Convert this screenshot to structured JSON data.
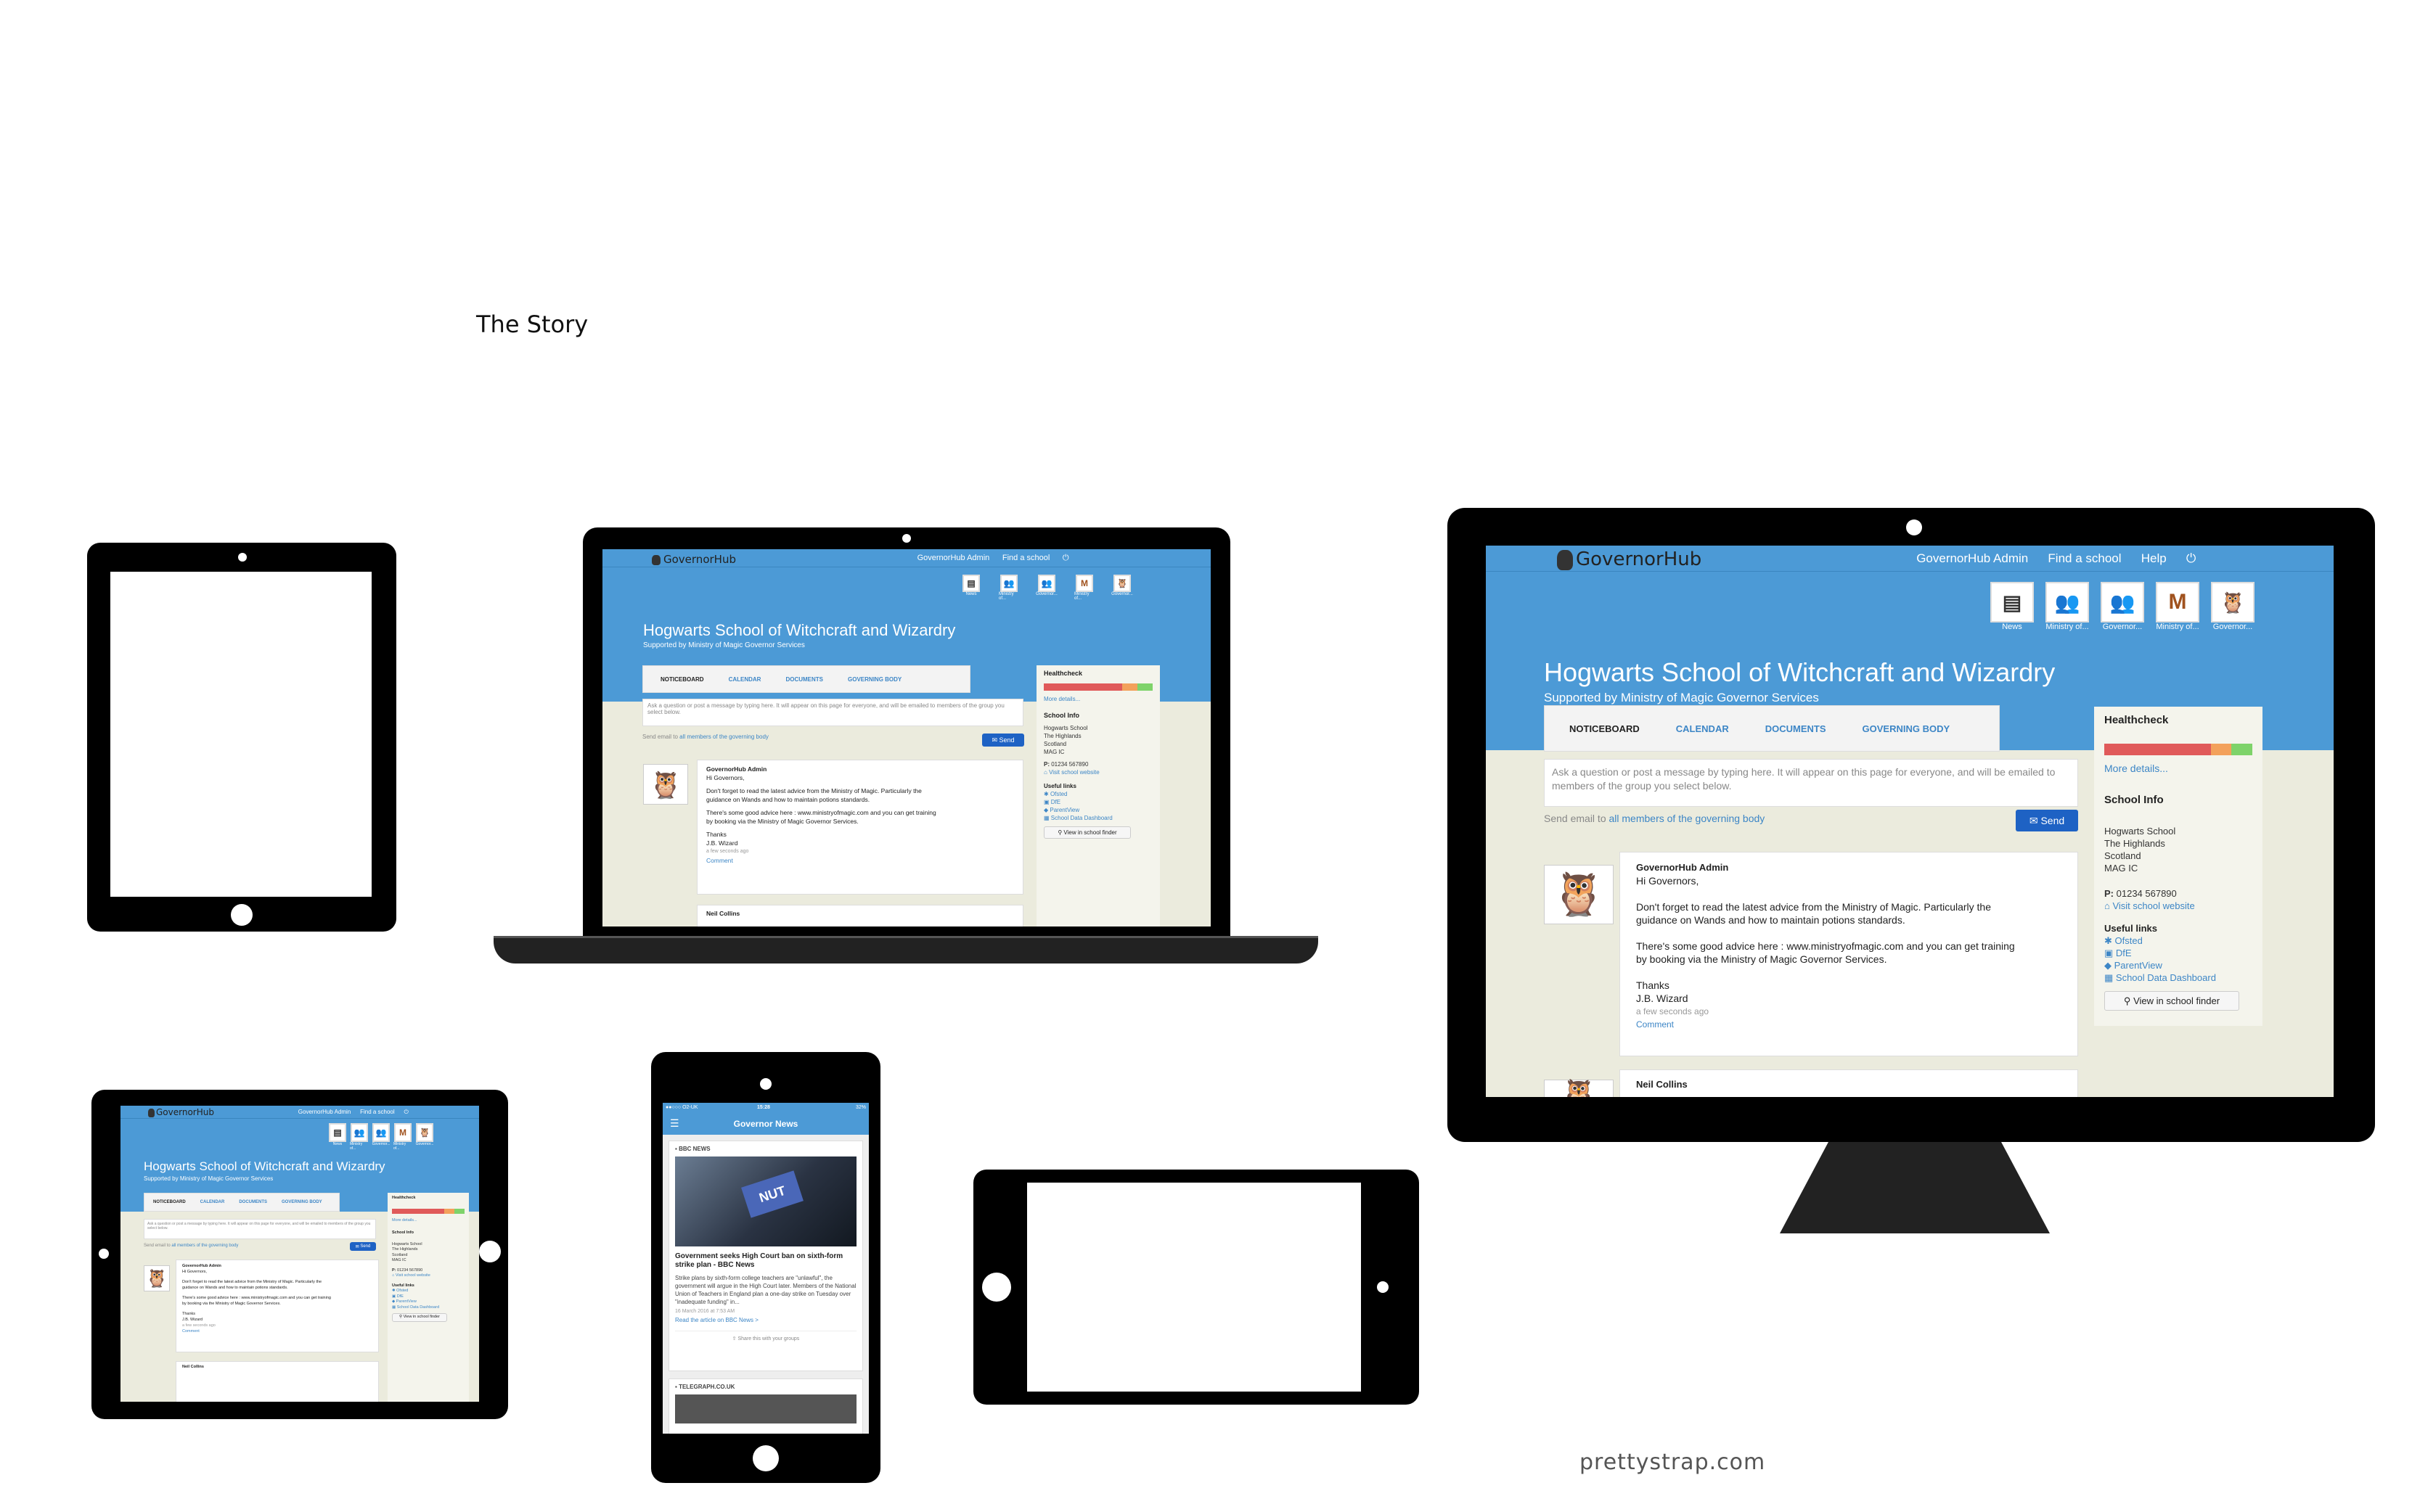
{
  "page_title": "The Story",
  "footer_brand": "prettystrap.com",
  "site": {
    "logo": "GovernorHub",
    "nav": {
      "admin": "GovernorHub Admin",
      "find": "Find a school",
      "help": "Help"
    },
    "groups": [
      "News",
      "Ministry of...",
      "Governor...",
      "Ministry of...",
      "Governor..."
    ],
    "school_name": "Hogwarts School of Witchcraft and Wizardry",
    "school_sub": "Supported by Ministry of Magic Governor Services",
    "tabs": [
      "NOTICEBOARD",
      "CALENDAR",
      "DOCUMENTS",
      "GOVERNING BODY"
    ],
    "post_placeholder": "Ask a question or post a message by typing here. It will appear on this page for everyone, and will be emailed to members of the group you select below.",
    "send_prefix": "Send email to",
    "send_link": "all members of the governing body",
    "send_button": "Send",
    "message": {
      "author": "GovernorHub Admin",
      "greeting": "Hi Governors,",
      "line1": "Don't forget to read the latest advice from the Ministry of Magic.  Particularly the",
      "line2": "guidance on Wands and how to maintain potions standards.",
      "line3": "There's some good advice here : www.ministryofmagic.com and you can get training",
      "line4": "by booking via the Ministry of Magic Governor Services.",
      "thanks": "Thanks",
      "sign": "J.B. Wizard",
      "time": "a few seconds ago",
      "comment": "Comment"
    },
    "next_author": "Neil Collins",
    "healthcheck": {
      "title": "Healthcheck",
      "more": "More details...",
      "segments": [
        0.72,
        0.14,
        0.14
      ]
    },
    "school_info": {
      "title": "School Info",
      "addr1": "Hogwarts School",
      "addr2": "The Highlands",
      "addr3": "Scotland",
      "addr4": "MAG IC",
      "phone": "01234 567890",
      "phone_prefix": "P:",
      "website": "Visit school website"
    },
    "useful": {
      "title": "Useful links",
      "links": [
        "Ofsted",
        "DfE",
        "ParentView",
        "School Data Dashboard"
      ],
      "finder": "View in school finder"
    }
  },
  "phone": {
    "status_left": "●●○○○ O2-UK",
    "status_time": "15:28",
    "status_right": "32%",
    "header": "Governor News",
    "source1": "BBC NEWS",
    "headline": "Government seeks High Court ban on sixth-form strike plan - BBC News",
    "body": "Strike plans by sixth-form college teachers are \"unlawful\", the government will argue in the High Court later. Members of the National Union of Teachers in England plan a one-day strike on Tuesday over \"inadequate funding\" in...",
    "date": "16 March 2016 at 7:53 AM",
    "read_more": "Read the article on BBC News >",
    "share": "Share this with your groups",
    "source2": "TELEGRAPH.CO.UK"
  },
  "colors": {
    "brand": "#4c9ad6",
    "page_bg": "#ebebdd",
    "link": "#3d86c6",
    "send": "#1e62c4",
    "health_red": "#e05a5a",
    "health_orange": "#f3a15b",
    "health_green": "#7ed36a"
  }
}
